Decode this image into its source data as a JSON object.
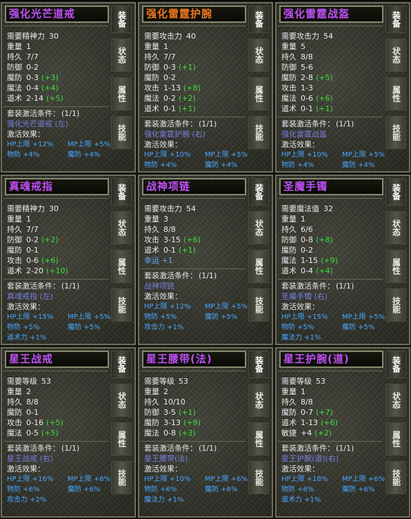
{
  "tabs": [
    "装备",
    "状态",
    "属性",
    "技能"
  ],
  "set_condition_label": "套装激活条件：",
  "effect_label": "激活效果：",
  "cards": [
    {
      "title": "强化光芒道戒",
      "title_color": "purple",
      "stats": [
        {
          "label": "需要精神力",
          "value": "30"
        },
        {
          "label": "重量",
          "value": "1"
        },
        {
          "label": "持久",
          "value": "7/7"
        },
        {
          "label": "防御",
          "value": "0-2"
        },
        {
          "label": "魔防",
          "value": "0-3",
          "bonus": "(+3)"
        },
        {
          "label": "魔法",
          "value": "0-4",
          "bonus": "(+4)"
        },
        {
          "label": "道术",
          "value": "2-14",
          "bonus": "(+5)"
        }
      ],
      "set_count": "(1/1)",
      "set_item": "强化光芒道戒 (左)",
      "effects": [
        [
          "HP上限 +12%",
          "MP上限 +5%"
        ],
        [
          "物防 +4%",
          "魔防 +4%"
        ]
      ]
    },
    {
      "title": "强化雷霆护腕",
      "title_color": "orange",
      "stats": [
        {
          "label": "需要攻击力",
          "value": "40"
        },
        {
          "label": "重量",
          "value": "1"
        },
        {
          "label": "持久",
          "value": "7/7"
        },
        {
          "label": "防御",
          "value": "0-3",
          "bonus": "(+1)"
        },
        {
          "label": "魔防",
          "value": "0-2"
        },
        {
          "label": "攻击",
          "value": "1-13",
          "bonus": "(+8)"
        },
        {
          "label": "魔法",
          "value": "0-2",
          "bonus": "(+2)"
        },
        {
          "label": "道术",
          "value": "0-1",
          "bonus": "(+1)"
        }
      ],
      "set_count": "(1/1)",
      "set_item": "强化雷霆护腕 (右)",
      "effects": [
        [
          "HP上限 +10%",
          "MP上限 +5%"
        ],
        [
          "物防 +4%",
          "魔防 +4%"
        ]
      ]
    },
    {
      "title": "强化雷霆战盔",
      "title_color": "purple",
      "stats": [
        {
          "label": "需要攻击力",
          "value": "54"
        },
        {
          "label": "重量",
          "value": "5"
        },
        {
          "label": "持久",
          "value": "8/8"
        },
        {
          "label": "防御",
          "value": "5-6"
        },
        {
          "label": "魔防",
          "value": "2-8",
          "bonus": "(+5)"
        },
        {
          "label": "攻击",
          "value": "1-3"
        },
        {
          "label": "魔法",
          "value": "0-6",
          "bonus": "(+6)"
        },
        {
          "label": "道术",
          "value": "0-1",
          "bonus": "(+1)"
        }
      ],
      "set_count": "(1/1)",
      "set_item": "强化雷霆战盔",
      "effects": [
        [
          "HP上限 +10%",
          "MP上限 +5%"
        ],
        [
          "物防 +4%",
          "魔防 +4%"
        ]
      ]
    },
    {
      "title": "真魂戒指",
      "title_color": "purple",
      "stats": [
        {
          "label": "需要精神力",
          "value": "30"
        },
        {
          "label": "重量",
          "value": "1"
        },
        {
          "label": "持久",
          "value": "7/7"
        },
        {
          "label": "防御",
          "value": "0-2",
          "bonus": "(+2)"
        },
        {
          "label": "魔防",
          "value": "0-1"
        },
        {
          "label": "攻击",
          "value": "0-6",
          "bonus": "(+6)"
        },
        {
          "label": "道术",
          "value": "2-20",
          "bonus": "(+10)"
        }
      ],
      "set_count": "(1/1)",
      "set_item": "真魂戒指 (左)",
      "effects": [
        [
          "HP上限 +15%",
          "MP上限 +5%"
        ],
        [
          "物防 +5%",
          "魔防 +5%"
        ],
        [
          "道术力 +1%"
        ]
      ]
    },
    {
      "title": "战神项链",
      "title_color": "purple",
      "stats": [
        {
          "label": "需要攻击力",
          "value": "54"
        },
        {
          "label": "重量",
          "value": "3"
        },
        {
          "label": "持久",
          "value": "8/8"
        },
        {
          "label": "攻击",
          "value": "3-15",
          "bonus": "(+6)"
        },
        {
          "label": "道术",
          "value": "0-1",
          "bonus": "(+1)"
        },
        {
          "label": "幸运 +1",
          "plain": true
        }
      ],
      "set_count": "(1/1)",
      "set_item": "战神项链",
      "effects": [
        [
          "HP上限 +12%",
          "MP上限 +5%"
        ],
        [
          "物防 +5%",
          "魔防 +5%"
        ],
        [
          "攻击力 +1%"
        ]
      ]
    },
    {
      "title": "圣魔手镯",
      "title_color": "purple",
      "stats": [
        {
          "label": "需要魔法值",
          "value": "32"
        },
        {
          "label": "重量",
          "value": "1"
        },
        {
          "label": "持久",
          "value": "6/6"
        },
        {
          "label": "防御",
          "value": "0-8",
          "bonus": "(+8)"
        },
        {
          "label": "魔防",
          "value": "0-2"
        },
        {
          "label": "魔法",
          "value": "1-15",
          "bonus": "(+9)"
        },
        {
          "label": "道术",
          "value": "0-4",
          "bonus": "(+4)"
        }
      ],
      "set_count": "(1/1)",
      "set_item": "圣魔手镯 (右)",
      "effects": [
        [
          "HP上限 +15%",
          "MP上限 +5%"
        ],
        [
          "物防 +5%",
          "魔防 +5%"
        ],
        [
          "魔法力 +1%"
        ]
      ]
    },
    {
      "title": "星王战戒",
      "title_color": "purple",
      "stats": [
        {
          "label": "需要等级",
          "value": "53"
        },
        {
          "label": "重量",
          "value": "2"
        },
        {
          "label": "持久",
          "value": "8/8"
        },
        {
          "label": "魔防",
          "value": "0-1"
        },
        {
          "label": "攻击",
          "value": "0-16",
          "bonus": "(+5)"
        },
        {
          "label": "魔法",
          "value": "0-5",
          "bonus": "(+5)"
        }
      ],
      "set_count": "(1/1)",
      "set_item": "星王战戒 (右)",
      "effects": [
        [
          "HP上限 +16%",
          "MP上限 +6%"
        ],
        [
          "物防 +6%",
          "魔防 +6%"
        ],
        [
          "攻击力 +2%"
        ]
      ]
    },
    {
      "title": "星王腰带(法)",
      "title_color": "purple",
      "stats": [
        {
          "label": "需要等级",
          "value": "53"
        },
        {
          "label": "重量",
          "value": "2"
        },
        {
          "label": "持久",
          "value": "10/10"
        },
        {
          "label": "防御",
          "value": "3-5",
          "bonus": "(+1)"
        },
        {
          "label": "魔防",
          "value": "3-13",
          "bonus": "(+9)"
        },
        {
          "label": "魔法",
          "value": "0-8",
          "bonus": "(+3)"
        }
      ],
      "set_count": "(1/1)",
      "set_item": "星王腰带(法)",
      "effects": [
        [
          "HP上限 +10%",
          "MP上限 +6%"
        ],
        [
          "物防 +6%",
          "魔防 +6%"
        ],
        [
          "魔法力 +1%"
        ]
      ]
    },
    {
      "title": "星王护腕(道)",
      "title_color": "purple",
      "stats": [
        {
          "label": "需要等级",
          "value": "53"
        },
        {
          "label": "重量",
          "value": "1"
        },
        {
          "label": "持久",
          "value": "8/8"
        },
        {
          "label": "魔防",
          "value": "0-7",
          "bonus": "(+7)"
        },
        {
          "label": "道术",
          "value": "1-13",
          "bonus": "(+6)"
        },
        {
          "label": "敏捷",
          "value": "+4",
          "bonus": "(+2)"
        }
      ],
      "set_count": "(1/1)",
      "set_item": "星王护腕(道)(右)",
      "effects": [
        [
          "HP上限 +18%",
          "MP上限 +6%"
        ],
        [
          "物防 +6%",
          "魔防 +6%"
        ],
        [
          "道术力 +1%"
        ]
      ]
    }
  ]
}
